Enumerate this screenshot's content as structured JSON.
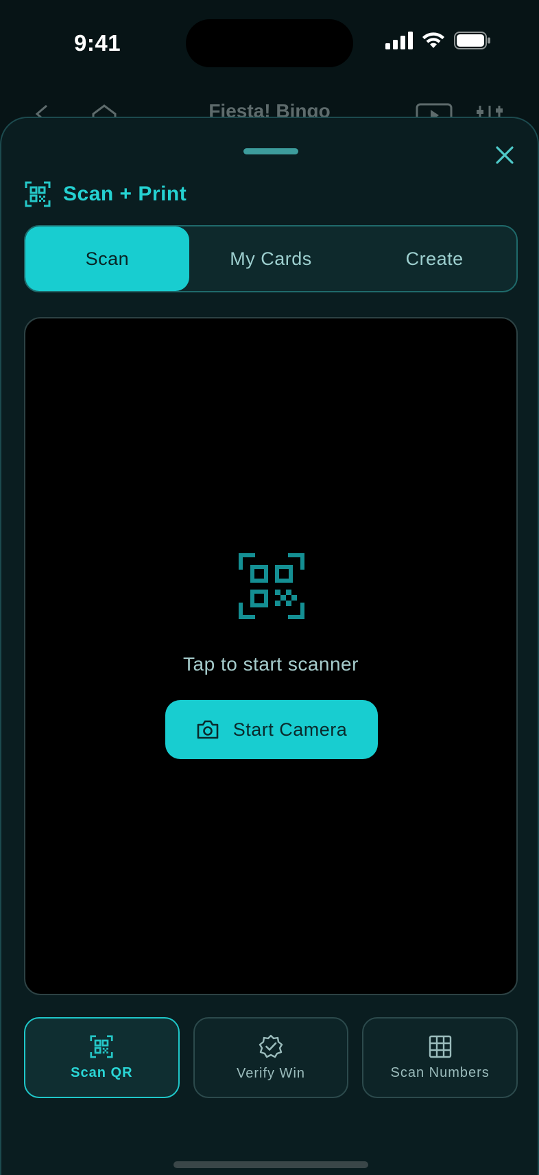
{
  "status_bar": {
    "time": "9:41"
  },
  "background_app": {
    "title": "Fiesta! Bingo"
  },
  "sheet": {
    "title": "Scan + Print",
    "tabs": [
      {
        "label": "Scan",
        "active": true
      },
      {
        "label": "My Cards",
        "active": false
      },
      {
        "label": "Create",
        "active": false
      }
    ],
    "scanner": {
      "hint": "Tap to start scanner",
      "start_button": "Start Camera"
    },
    "actions": [
      {
        "label": "Scan QR",
        "icon": "qr-code-icon",
        "active": true
      },
      {
        "label": "Verify Win",
        "icon": "badge-check-icon",
        "active": false
      },
      {
        "label": "Scan Numbers",
        "icon": "grid-icon",
        "active": false
      }
    ]
  },
  "colors": {
    "accent": "#18cdd0",
    "sheet_bg": "#0a1d20",
    "scanner_bg": "#000000"
  }
}
